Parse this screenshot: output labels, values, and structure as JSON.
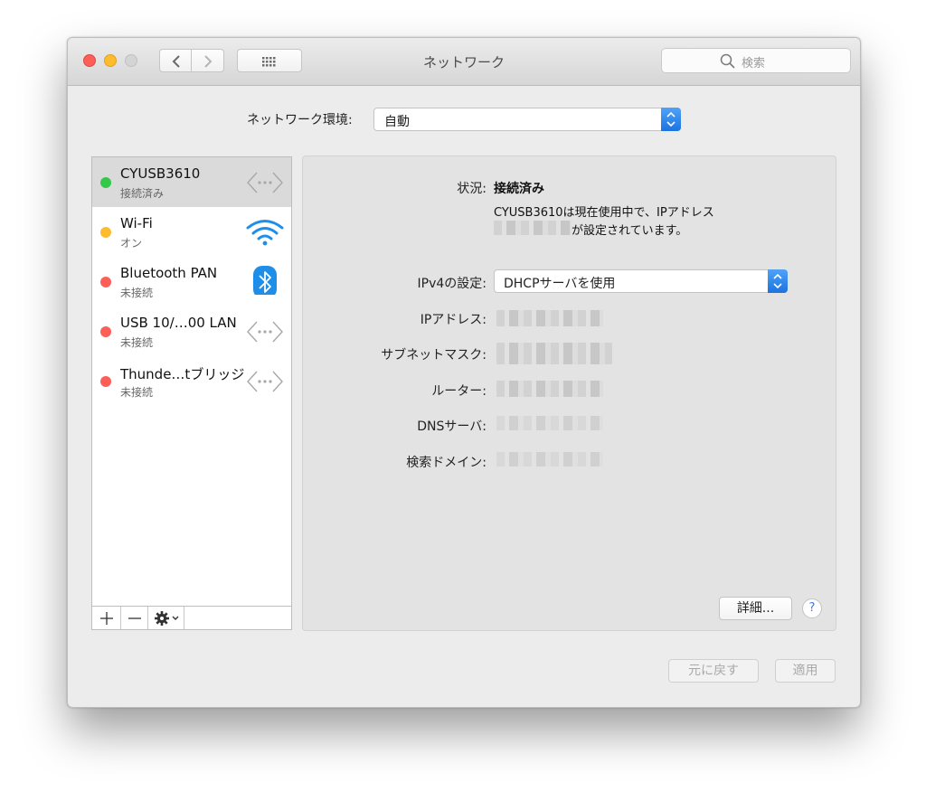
{
  "window": {
    "title": "ネットワーク",
    "search_placeholder": "検索"
  },
  "location": {
    "label": "ネットワーク環境:",
    "value": "自動"
  },
  "services": [
    {
      "name": "CYUSB3610",
      "status": "接続済み",
      "dot": "#34c84a",
      "icon": "ethernet-arrows-icon",
      "selected": true
    },
    {
      "name": "Wi-Fi",
      "status": "オン",
      "dot": "#fdbc2f",
      "icon": "wifi-icon",
      "selected": false
    },
    {
      "name": "Bluetooth PAN",
      "status": "未接続",
      "dot": "#fc5f57",
      "icon": "bluetooth-icon",
      "selected": false
    },
    {
      "name": "USB 10/…00 LAN",
      "status": "未接続",
      "dot": "#fc5f57",
      "icon": "ethernet-arrows-icon",
      "selected": false
    },
    {
      "name": "Thunde…tブリッジ",
      "status": "未接続",
      "dot": "#fc5f57",
      "icon": "ethernet-arrows-icon",
      "selected": false
    }
  ],
  "sidebar_footer": {
    "add": "+",
    "remove": "−"
  },
  "detail": {
    "status_label": "状況:",
    "status_value": "接続済み",
    "status_desc_line1": "CYUSB3610は現在使用中で、IPアドレス",
    "status_desc_line2": "が設定されています。",
    "ipv4_label": "IPv4の設定:",
    "ipv4_value": "DHCPサーバを使用",
    "ip_label": "IPアドレス:",
    "subnet_label": "サブネットマスク:",
    "router_label": "ルーター:",
    "dns_label": "DNSサーバ:",
    "search_domain_label": "検索ドメイン:",
    "advanced_button": "詳細...",
    "help_button": "?"
  },
  "footer": {
    "revert": "元に戻す",
    "apply": "適用"
  },
  "colors": {
    "accent": "#1c73e0",
    "green": "#34c84a",
    "yellow": "#fdbc2f",
    "red": "#fc5f57"
  }
}
